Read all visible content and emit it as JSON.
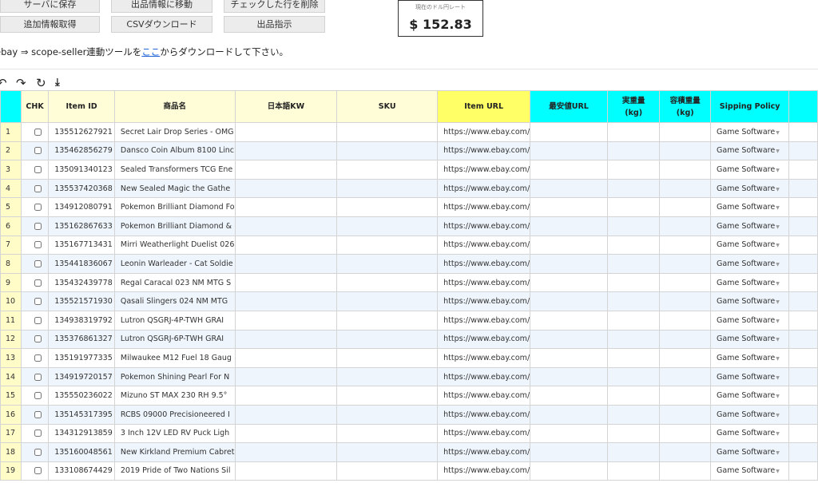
{
  "toolbar": {
    "save_label": "サーバに保存",
    "goto_listing_label": "出品情報に移動",
    "delete_checked_label": "チェックした行を削除",
    "additional_info_label": "追加情報取得",
    "csv_download_label": "CSVダウンロード",
    "listing_instruction_label": "出品指示"
  },
  "rate": {
    "label": "現在のドル円レート",
    "value": "$ 152.83"
  },
  "notice": {
    "prefix": "ebay ⇒ scope-seller連動ツールを",
    "link": "ここ",
    "suffix": "からダウンロードして下さい。"
  },
  "icons": {
    "undo": "↶",
    "redo": "↷",
    "refresh": "↻",
    "download": "⤓"
  },
  "table": {
    "headers": {
      "chk": "CHK",
      "item_id": "Item ID",
      "product_name": "商品名",
      "japanese_kw": "日本語KW",
      "sku": "SKU",
      "item_url": "Item URL",
      "cheapest_url": "最安値URL",
      "actual_weight": "実重量\n(kg)",
      "volume_weight": "容積重量\n(kg)",
      "shipping_policy": "Sipping Policy"
    },
    "rows": [
      {
        "num": "1",
        "item_id": "135512627921",
        "name": "Secret Lair Drop Series - OMG",
        "url": "https://www.ebay.com/",
        "policy": "Game Software"
      },
      {
        "num": "2",
        "item_id": "135462856279",
        "name": "Dansco Coin Album 8100 Linc",
        "url": "https://www.ebay.com/",
        "policy": "Game Software"
      },
      {
        "num": "3",
        "item_id": "135091340123",
        "name": "Sealed Transformers TCG Ene",
        "url": "https://www.ebay.com/",
        "policy": "Game Software"
      },
      {
        "num": "4",
        "item_id": "135537420368",
        "name": "New Sealed Magic the Gathe",
        "url": "https://www.ebay.com/",
        "policy": "Game Software"
      },
      {
        "num": "5",
        "item_id": "134912080791",
        "name": "Pokemon Brilliant Diamond Fo",
        "url": "https://www.ebay.com/",
        "policy": "Game Software"
      },
      {
        "num": "6",
        "item_id": "135162867633",
        "name": "Pokemon Brilliant Diamond &",
        "url": "https://www.ebay.com/",
        "policy": "Game Software"
      },
      {
        "num": "7",
        "item_id": "135167713431",
        "name": "Mirri Weatherlight Duelist 026",
        "url": "https://www.ebay.com/",
        "policy": "Game Software"
      },
      {
        "num": "8",
        "item_id": "135441836067",
        "name": "Leonin Warleader - Cat Soldie",
        "url": "https://www.ebay.com/",
        "policy": "Game Software"
      },
      {
        "num": "9",
        "item_id": "135432439778",
        "name": "Regal Caracal 023 NM MTG S",
        "url": "https://www.ebay.com/",
        "policy": "Game Software"
      },
      {
        "num": "10",
        "item_id": "135521571930",
        "name": "Qasali Slingers 024 NM MTG",
        "url": "https://www.ebay.com/",
        "policy": "Game Software"
      },
      {
        "num": "11",
        "item_id": "134938319792",
        "name": "Lutron QSGRJ-4P-TWH GRAI",
        "url": "https://www.ebay.com/",
        "policy": "Game Software"
      },
      {
        "num": "12",
        "item_id": "135376861327",
        "name": "Lutron QSGRJ-6P-TWH GRAI",
        "url": "https://www.ebay.com/",
        "policy": "Game Software"
      },
      {
        "num": "13",
        "item_id": "135191977335",
        "name": "Milwaukee M12 Fuel 18 Gaug",
        "url": "https://www.ebay.com/",
        "policy": "Game Software"
      },
      {
        "num": "14",
        "item_id": "134919720157",
        "name": "Pokemon Shining Pearl For N",
        "url": "https://www.ebay.com/",
        "policy": "Game Software"
      },
      {
        "num": "15",
        "item_id": "135550236022",
        "name": "Mizuno ST MAX 230 RH 9.5°",
        "url": "https://www.ebay.com/",
        "policy": "Game Software"
      },
      {
        "num": "16",
        "item_id": "135145317395",
        "name": "RCBS 09000 Precisioneered I",
        "url": "https://www.ebay.com/",
        "policy": "Game Software"
      },
      {
        "num": "17",
        "item_id": "134312913859",
        "name": "3 Inch 12V LED RV Puck Ligh",
        "url": "https://www.ebay.com/",
        "policy": "Game Software"
      },
      {
        "num": "18",
        "item_id": "135160048561",
        "name": "New Kirkland Premium Cabret",
        "url": "https://www.ebay.com/",
        "policy": "Game Software"
      },
      {
        "num": "19",
        "item_id": "133108674429",
        "name": "2019 Pride of Two Nations Sil",
        "url": "https://www.ebay.com/",
        "policy": "Game Software"
      }
    ]
  }
}
